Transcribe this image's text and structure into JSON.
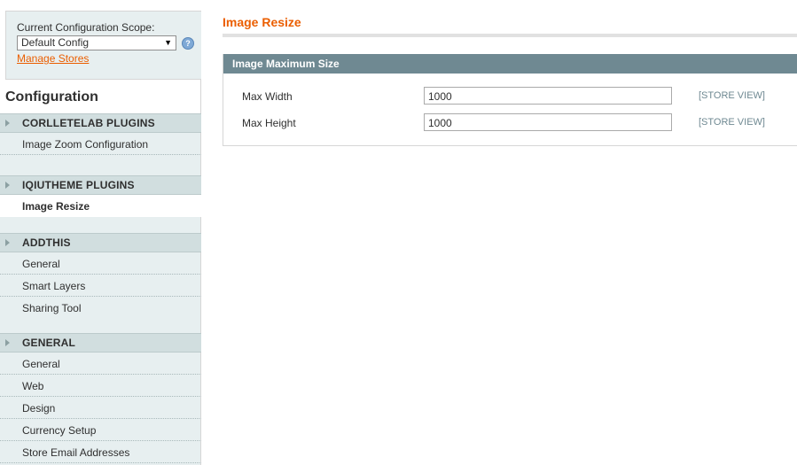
{
  "scope": {
    "label": "Current Configuration Scope:",
    "selected": "Default Config",
    "manage_link": "Manage Stores"
  },
  "sidebar": {
    "title": "Configuration",
    "groups": [
      {
        "label": "CORLLETELAB PLUGINS",
        "items": [
          "Image Zoom Configuration"
        ]
      },
      {
        "label": "IQIUTHEME PLUGINS",
        "items": [
          "Image Resize"
        ]
      },
      {
        "label": "ADDTHIS",
        "items": [
          "General",
          "Smart Layers",
          "Sharing Tool"
        ]
      },
      {
        "label": "GENERAL",
        "items": [
          "General",
          "Web",
          "Design",
          "Currency Setup",
          "Store Email Addresses"
        ]
      }
    ]
  },
  "main": {
    "title": "Image Resize",
    "section": {
      "title": "Image Maximum Size",
      "fields": [
        {
          "label": "Max Width",
          "value": "1000",
          "scope": "[STORE VIEW]"
        },
        {
          "label": "Max Height",
          "value": "1000",
          "scope": "[STORE VIEW]"
        }
      ]
    }
  },
  "colors": {
    "accent": "#eb5e00",
    "section_header": "#6f8992",
    "sidebar_bg": "#e7eff0",
    "group_header_bg": "#d1dedf"
  },
  "icons": {
    "help": "help-icon",
    "group_arrow": "triangle-right-icon",
    "select_arrow": "chevron-down-icon"
  }
}
